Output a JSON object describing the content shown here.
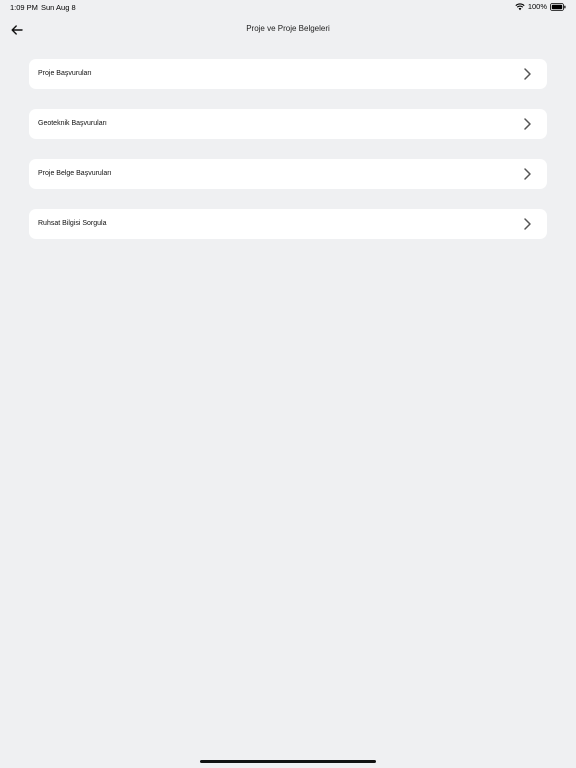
{
  "status_bar": {
    "time": "1:09 PM",
    "date": "Sun Aug 8",
    "battery": "100%",
    "wifi_icon": "wifi-icon",
    "battery_icon": "battery-icon"
  },
  "nav": {
    "title": "Proje ve Proje Belgeleri",
    "back_icon": "arrow-left-icon"
  },
  "menu": {
    "items": [
      {
        "label": "Proje Başvuruları",
        "icon": "chevron-right-icon"
      },
      {
        "label": "Geoteknik Başvuruları",
        "icon": "chevron-right-icon"
      },
      {
        "label": "Proje Belge Başvuruları",
        "icon": "chevron-right-icon"
      },
      {
        "label": "Ruhsat Bilgisi Sorgula",
        "icon": "chevron-right-icon"
      }
    ]
  }
}
